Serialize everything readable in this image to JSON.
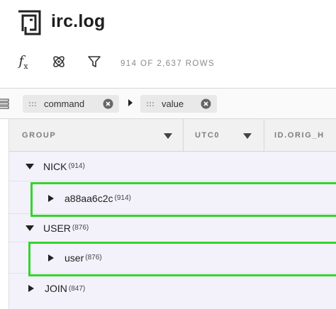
{
  "app": {
    "title": "irc.log",
    "rows_count": "914 OF 2,637 ROWS"
  },
  "toolbar": {
    "formula_label": "f",
    "formula_sub": "x"
  },
  "group_by": {
    "chips": [
      {
        "label": "command"
      },
      {
        "label": "value"
      }
    ]
  },
  "grid": {
    "columns": [
      {
        "label": "GROUP"
      },
      {
        "label": "UTC0"
      },
      {
        "label": "ID.ORIG_H"
      }
    ],
    "rows": [
      {
        "label": "NICK",
        "count": "(914)",
        "expanded": true,
        "level": 1
      },
      {
        "label": "a88aa6c2c",
        "count": "(914)",
        "expanded": false,
        "level": 2
      },
      {
        "label": "USER",
        "count": "(876)",
        "expanded": true,
        "level": 1
      },
      {
        "label": "user",
        "count": "(876)",
        "expanded": false,
        "level": 2
      },
      {
        "label": "JOIN",
        "count": "(847)",
        "expanded": false,
        "level": 1
      }
    ]
  },
  "colors": {
    "highlight": "#35d42c",
    "grid_bg": "#f3f2fb"
  }
}
